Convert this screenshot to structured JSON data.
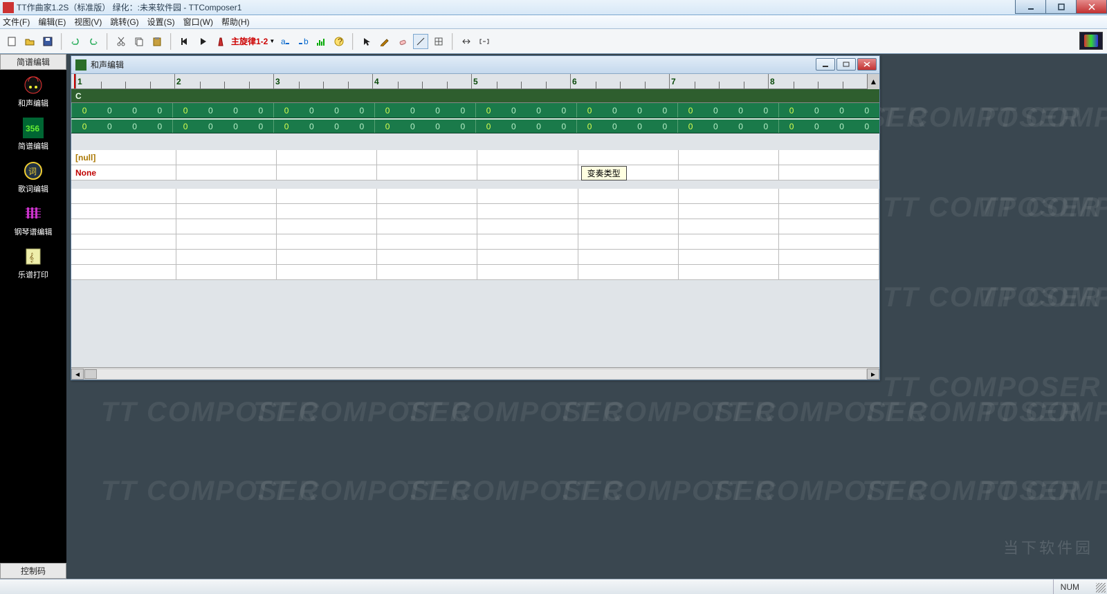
{
  "titlebar": {
    "title": "TT作曲家1.2S（标准版） 绿化：:未来软件园 - TTComposer1"
  },
  "menu": {
    "file": "文件(F)",
    "edit": "编辑(E)",
    "view": "视图(V)",
    "jump": "跳转(G)",
    "settings": "设置(S)",
    "window": "窗口(W)",
    "help": "帮助(H)"
  },
  "toolbar": {
    "melody": "主旋律1-2"
  },
  "sidebar": {
    "header": "简谱编辑",
    "footer": "控制码",
    "items": [
      {
        "label": "和声编辑"
      },
      {
        "label": "简谱编辑"
      },
      {
        "label": "歌词编辑"
      },
      {
        "label": "钢琴谱编辑"
      },
      {
        "label": "乐谱打印"
      }
    ]
  },
  "child": {
    "title": "和声编辑",
    "ruler_bars": [
      "1",
      "2",
      "3",
      "4",
      "5",
      "6",
      "7",
      "8"
    ],
    "key_row": "C",
    "zero_value": "0",
    "null_text": "[null]",
    "none_text": "None",
    "tooltip": "变奏类型"
  },
  "statusbar": {
    "num": "NUM"
  },
  "watermark_corner": "当下软件园"
}
